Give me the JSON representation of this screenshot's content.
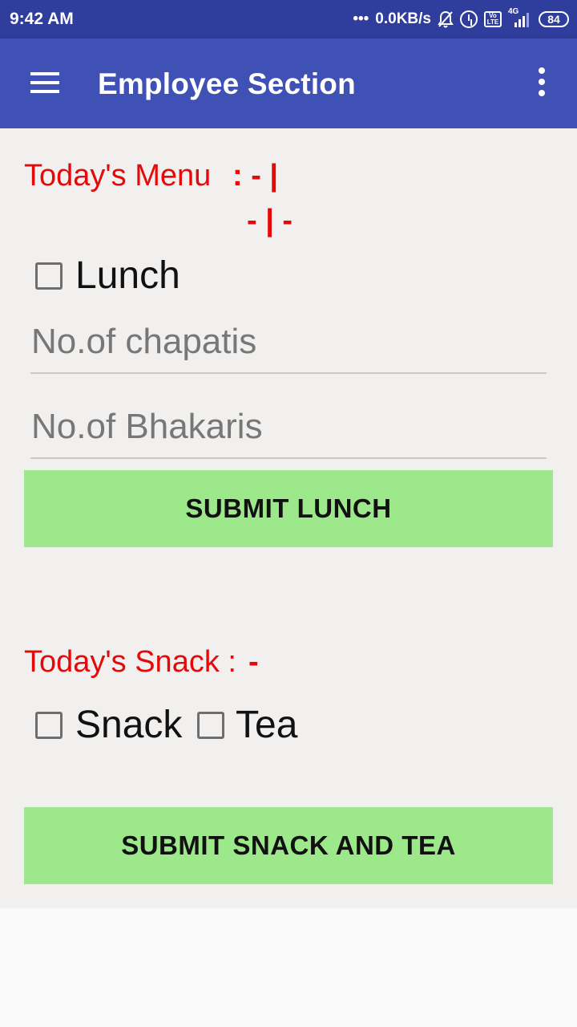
{
  "status_bar": {
    "time": "9:42 AM",
    "network_speed": "0.0KB/s",
    "volte_label": "Vo LTE",
    "network_type": "4G",
    "battery": "84"
  },
  "app_bar": {
    "title": "Employee Section",
    "menu_icon": "hamburger-menu-icon",
    "overflow_icon": "more-vert-icon"
  },
  "menu_section": {
    "label": "Today's Menu",
    "value_line1": ": - |",
    "value_line2": "- | -",
    "lunch_label": "Lunch",
    "lunch_checked": false,
    "chapatis_placeholder": "No.of chapatis",
    "chapatis_value": "",
    "bhakaris_placeholder": "No.of Bhakaris",
    "bhakaris_value": "",
    "submit_label": "SUBMIT LUNCH"
  },
  "snack_section": {
    "label": "Today's Snack :",
    "value": "-",
    "snack_label": "Snack",
    "snack_checked": false,
    "tea_label": "Tea",
    "tea_checked": false,
    "submit_label": "SUBMIT SNACK AND TEA"
  },
  "colors": {
    "status_bar": "#2f3d9c",
    "app_bar": "#3f51b5",
    "label_red": "#e50a0a",
    "button_green": "#9de88a",
    "content_bg": "#f1f0ef"
  }
}
